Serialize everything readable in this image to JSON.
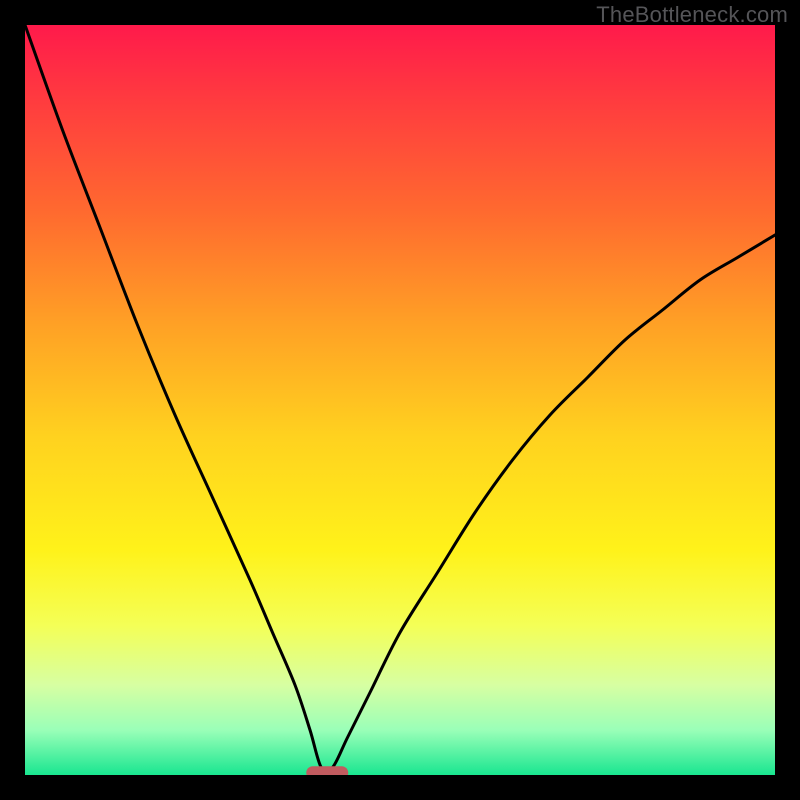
{
  "watermark": "TheBottleneck.com",
  "chart_data": {
    "type": "line",
    "title": "",
    "xlabel": "",
    "ylabel": "",
    "ylim": [
      0,
      100
    ],
    "xlim": [
      0,
      100
    ],
    "grid": false,
    "legend": false,
    "note": "Axes untitled / unticked in source image. Y visually maps 0→green (bottom) to 100→red (top). X is normalized 0–100. Single black curve with a sharp dip near x≈40; small red pill marker at the minimum.",
    "series": [
      {
        "name": "curve",
        "x": [
          0,
          5,
          10,
          15,
          20,
          25,
          30,
          33,
          36,
          38,
          39.5,
          41,
          43,
          46,
          50,
          55,
          60,
          65,
          70,
          75,
          80,
          85,
          90,
          95,
          100
        ],
        "y": [
          100,
          86,
          73,
          60,
          48,
          37,
          26,
          19,
          12,
          6,
          1,
          1,
          5,
          11,
          19,
          27,
          35,
          42,
          48,
          53,
          58,
          62,
          66,
          69,
          72
        ]
      }
    ],
    "marker": {
      "x": 40.3,
      "y": 0.3,
      "color": "#c15b5f"
    },
    "gradient_stops": [
      {
        "offset": 0.0,
        "color": "#ff1a4b"
      },
      {
        "offset": 0.1,
        "color": "#ff3b3f"
      },
      {
        "offset": 0.25,
        "color": "#ff6a2f"
      },
      {
        "offset": 0.4,
        "color": "#ffa125"
      },
      {
        "offset": 0.55,
        "color": "#ffd21f"
      },
      {
        "offset": 0.7,
        "color": "#fff21a"
      },
      {
        "offset": 0.8,
        "color": "#f4ff56"
      },
      {
        "offset": 0.88,
        "color": "#d7ffa2"
      },
      {
        "offset": 0.94,
        "color": "#9affb8"
      },
      {
        "offset": 1.0,
        "color": "#19e690"
      }
    ],
    "frame": {
      "border_px": 25,
      "border_color": "#000000"
    }
  }
}
